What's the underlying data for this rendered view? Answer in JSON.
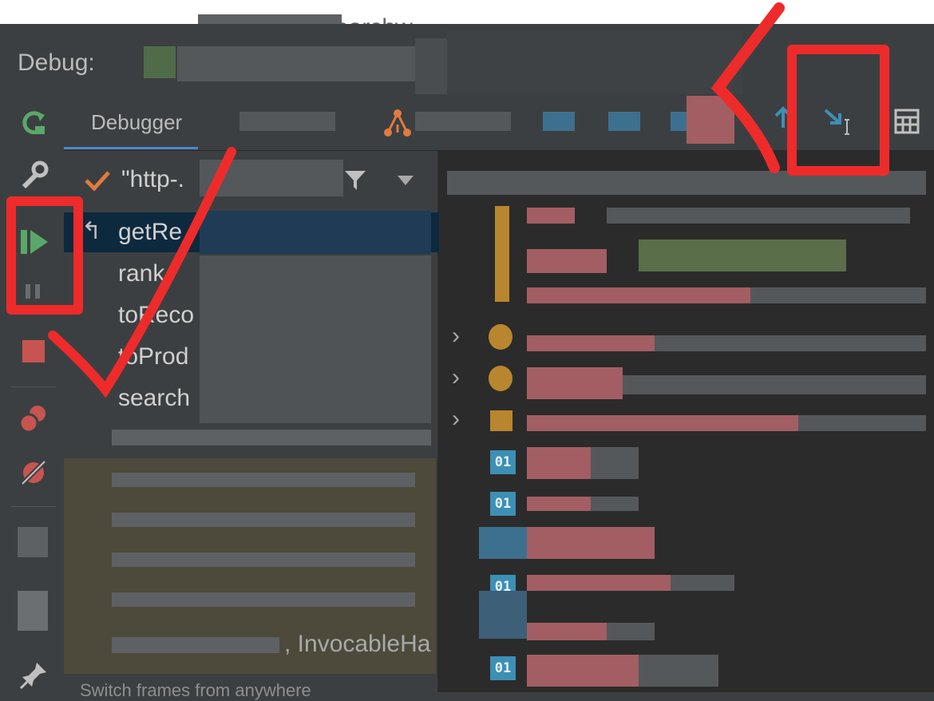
{
  "window": {
    "title_fragment": "earchw"
  },
  "debug_label": "Debug:",
  "tabs": {
    "debugger": "Debugger"
  },
  "thread": {
    "name": "\"http-."
  },
  "frames": [
    {
      "label": "getRe",
      "selected": true
    },
    {
      "label": "rank"
    },
    {
      "label": "toReco"
    },
    {
      "label": "toProd"
    },
    {
      "label": "search"
    }
  ],
  "console_fragment": ", InvocableHa",
  "tip_fragment": "Switch frames from anywhere",
  "icons": {
    "rerun": "rerun-icon",
    "settings": "wrench-icon",
    "resume": "resume-icon",
    "pause": "pause-icon",
    "stop": "stop-icon",
    "breakpoints": "view-breakpoints-icon",
    "mute": "mute-breakpoints-icon",
    "layout": "restore-layout-icon",
    "pin": "pin-icon",
    "filter": "filter-icon",
    "step_into": "force-step-into-icon",
    "evaluate": "evaluate-table-icon",
    "threads": "threads-icon"
  },
  "variable_badges": [
    "01",
    "01",
    "01",
    "01",
    "01"
  ],
  "colors": {
    "annotation": "#ee2b2b",
    "resume_green": "#59a869",
    "stop_red": "#c75450",
    "accent_blue": "#3d8fb4"
  }
}
